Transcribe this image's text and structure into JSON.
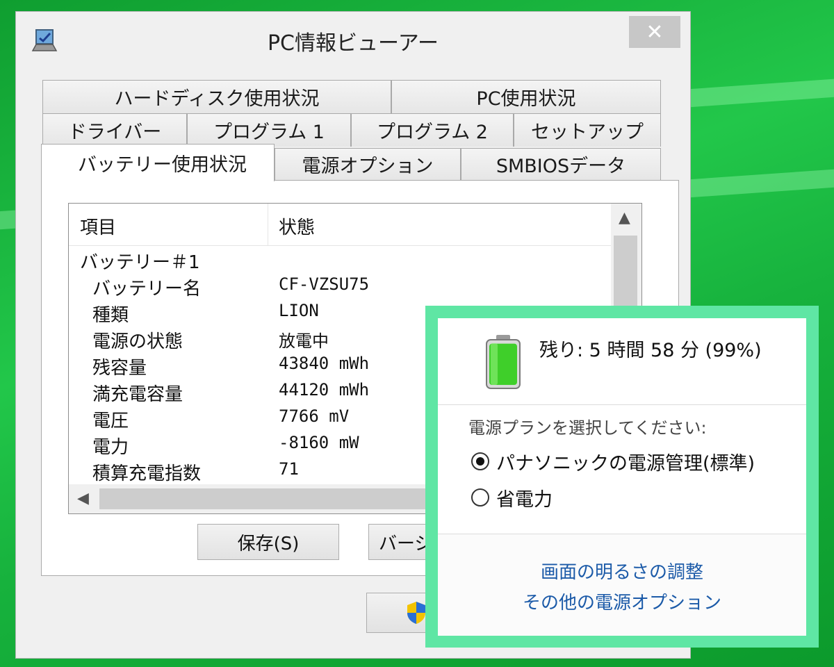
{
  "window": {
    "title": "PC情報ビューアー",
    "close_glyph": "✕"
  },
  "tabs": {
    "row1": [
      "ハードディスク使用状況",
      "PC使用状況"
    ],
    "row2": [
      "ドライバー",
      "プログラム 1",
      "プログラム 2",
      "セットアップ"
    ],
    "row3": [
      "バッテリー使用状況",
      "電源オプション",
      "SMBIOSデータ"
    ],
    "active": "バッテリー使用状況"
  },
  "list": {
    "columns": [
      "項目",
      "状態"
    ],
    "group": "バッテリー＃1",
    "rows": [
      {
        "item": "バッテリー名",
        "value": "CF-VZSU75"
      },
      {
        "item": "種類",
        "value": "LION"
      },
      {
        "item": "電源の状態",
        "value": "放電中"
      },
      {
        "item": "残容量",
        "value": "43840 mWh"
      },
      {
        "item": "満充電容量",
        "value": "44120 mWh"
      },
      {
        "item": "電圧",
        "value": "7766 mV"
      },
      {
        "item": "電力",
        "value": "-8160 mW"
      },
      {
        "item": "積算充電指数",
        "value": "71"
      }
    ]
  },
  "buttons": {
    "save": "保存(S)",
    "version": "バージ"
  },
  "flyout": {
    "remaining": "残り: 5 時間 58 分 (99%)",
    "battery_level": 0.99,
    "plan_prompt": "電源プランを選択してください:",
    "plans": [
      {
        "label": "パナソニックの電源管理(標準)",
        "selected": true
      },
      {
        "label": "省電力",
        "selected": false
      }
    ],
    "links": [
      "画面の明るさの調整",
      "その他の電源オプション"
    ]
  },
  "colors": {
    "desktop": "#16b43c",
    "flyout_border": "#5fe6a4",
    "link": "#1b5aa8"
  }
}
